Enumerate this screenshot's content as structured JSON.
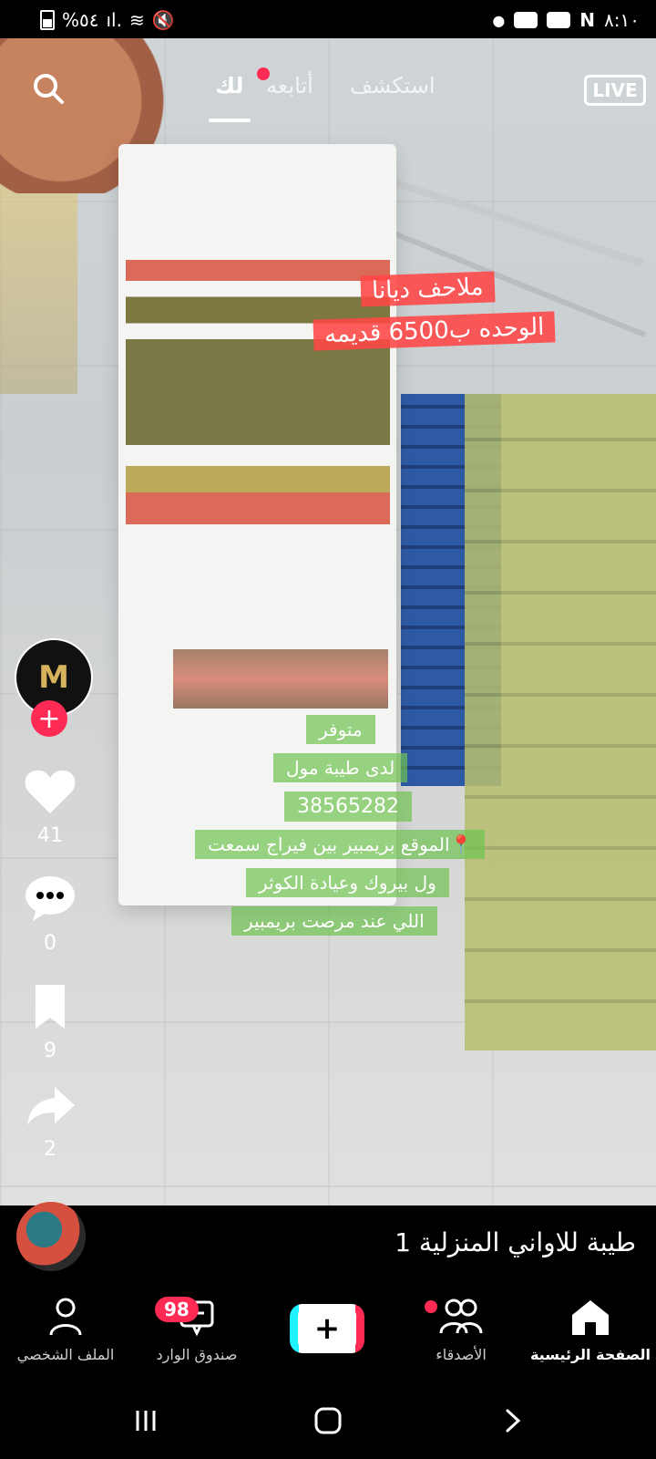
{
  "status_bar": {
    "battery": "%٥٤",
    "time": "٨:١٠"
  },
  "top_tabs": [
    {
      "label": "لك",
      "active": true
    },
    {
      "label": "أتابعه",
      "active": false
    },
    {
      "label": "استكشف",
      "active": false
    }
  ],
  "live_label": "LIVE",
  "video_overlay": {
    "red_line1": "ملاحف ديانا",
    "red_line2": "الوحده ب6500 قديمه",
    "green_lines": [
      "متوفر",
      "لدى طيبة مول",
      "38565282",
      "📍الموقع بريمبير بين فيراج سمعت",
      "ول بيروك وعيادة الكوثر",
      "اللي عند مرصت بريمبير"
    ]
  },
  "side_actions": {
    "likes": "41",
    "comments": "0",
    "saves": "9",
    "shares": "2"
  },
  "caption": "طيبة للاواني المنزلية 1",
  "bottom_nav": {
    "profile": "الملف الشخصي",
    "inbox": "صندوق الوارد",
    "inbox_badge": "98",
    "friends": "الأصدقاء",
    "home": "الصفحة الرئيسية"
  },
  "colors": {
    "accent": "#ff2b55",
    "cyan": "#21f2ff",
    "overlay_red": "#ff4646",
    "overlay_green": "#6ec350"
  }
}
